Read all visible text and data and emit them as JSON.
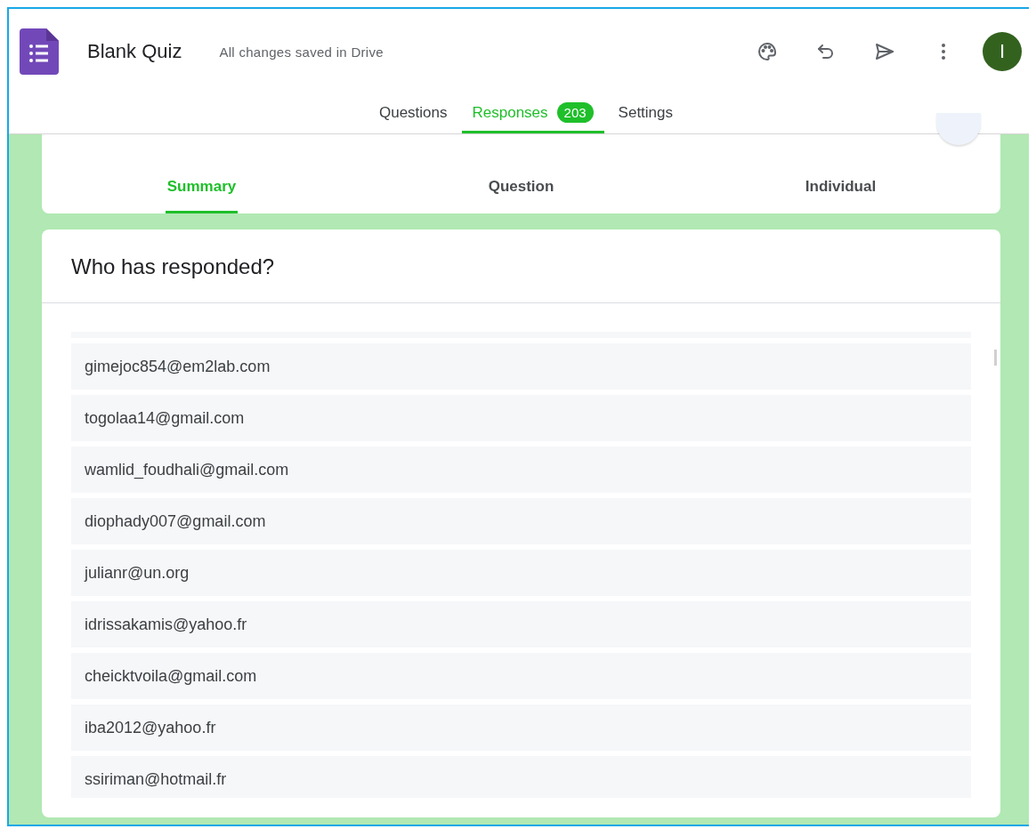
{
  "header": {
    "title": "Blank Quiz",
    "save_status": "All changes saved in Drive",
    "avatar_letter": "I"
  },
  "tabs": [
    {
      "label": "Questions",
      "selected": false
    },
    {
      "label": "Responses",
      "selected": true,
      "badge": "203"
    },
    {
      "label": "Settings",
      "selected": false
    }
  ],
  "subtabs": [
    {
      "label": "Summary",
      "selected": true
    },
    {
      "label": "Question",
      "selected": false
    },
    {
      "label": "Individual",
      "selected": false
    }
  ],
  "responders": {
    "title": "Who has responded?",
    "emails": [
      "gimejoc854@em2lab.com",
      "togolaa14@gmail.com",
      "wamlid_foudhali@gmail.com",
      "diophady007@gmail.com",
      "julianr@un.org",
      "idrissakamis@yahoo.fr",
      "cheicktvoila@gmail.com",
      "iba2012@yahoo.fr",
      "ssiriman@hotmail.fr"
    ]
  }
}
